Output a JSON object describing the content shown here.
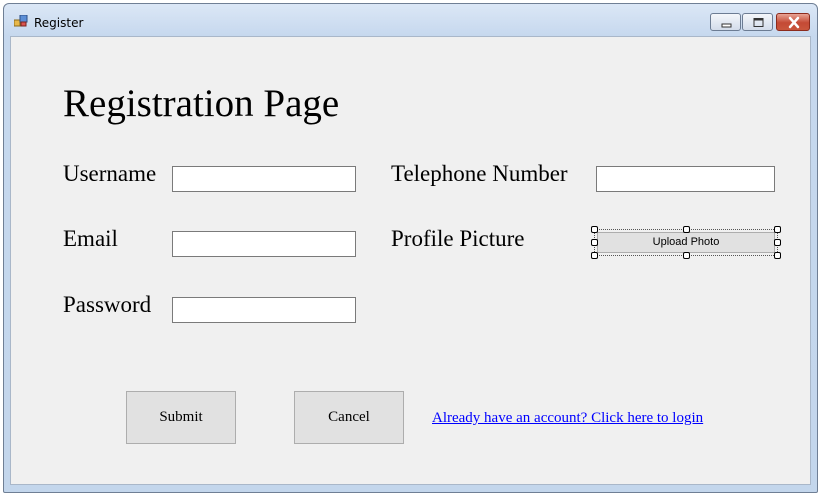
{
  "window": {
    "title": "Register",
    "controls": {
      "minimize": "minimize-icon",
      "maximize": "maximize-icon",
      "close": "close-icon"
    }
  },
  "form": {
    "heading": "Registration Page",
    "username_label": "Username",
    "username_value": "",
    "email_label": "Email",
    "email_value": "",
    "password_label": "Password",
    "password_value": "",
    "telephone_label": "Telephone Number",
    "telephone_value": "",
    "profile_label": "Profile Picture",
    "upload_button": "Upload Photo"
  },
  "actions": {
    "submit": "Submit",
    "cancel": "Cancel",
    "login_link": "Already have an account?  Click here to login"
  },
  "colors": {
    "client_background": "#f0f0f0",
    "link": "#0000ff",
    "close_button": "#c44a35"
  }
}
